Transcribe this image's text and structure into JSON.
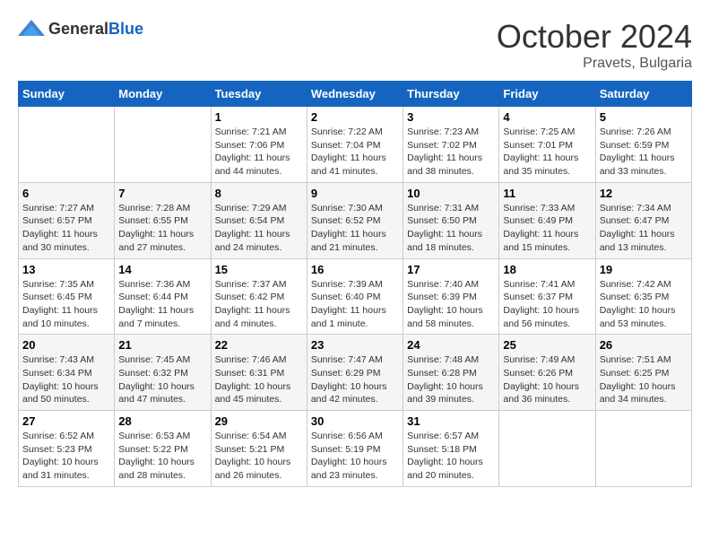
{
  "header": {
    "logo_general": "General",
    "logo_blue": "Blue",
    "month": "October 2024",
    "location": "Pravets, Bulgaria"
  },
  "weekdays": [
    "Sunday",
    "Monday",
    "Tuesday",
    "Wednesday",
    "Thursday",
    "Friday",
    "Saturday"
  ],
  "days": [
    {
      "date": null,
      "number": null
    },
    {
      "date": null,
      "number": null
    },
    {
      "number": "1",
      "sunrise": "Sunrise: 7:21 AM",
      "sunset": "Sunset: 7:06 PM",
      "daylight": "Daylight: 11 hours and 44 minutes."
    },
    {
      "number": "2",
      "sunrise": "Sunrise: 7:22 AM",
      "sunset": "Sunset: 7:04 PM",
      "daylight": "Daylight: 11 hours and 41 minutes."
    },
    {
      "number": "3",
      "sunrise": "Sunrise: 7:23 AM",
      "sunset": "Sunset: 7:02 PM",
      "daylight": "Daylight: 11 hours and 38 minutes."
    },
    {
      "number": "4",
      "sunrise": "Sunrise: 7:25 AM",
      "sunset": "Sunset: 7:01 PM",
      "daylight": "Daylight: 11 hours and 35 minutes."
    },
    {
      "number": "5",
      "sunrise": "Sunrise: 7:26 AM",
      "sunset": "Sunset: 6:59 PM",
      "daylight": "Daylight: 11 hours and 33 minutes."
    },
    {
      "number": "6",
      "sunrise": "Sunrise: 7:27 AM",
      "sunset": "Sunset: 6:57 PM",
      "daylight": "Daylight: 11 hours and 30 minutes."
    },
    {
      "number": "7",
      "sunrise": "Sunrise: 7:28 AM",
      "sunset": "Sunset: 6:55 PM",
      "daylight": "Daylight: 11 hours and 27 minutes."
    },
    {
      "number": "8",
      "sunrise": "Sunrise: 7:29 AM",
      "sunset": "Sunset: 6:54 PM",
      "daylight": "Daylight: 11 hours and 24 minutes."
    },
    {
      "number": "9",
      "sunrise": "Sunrise: 7:30 AM",
      "sunset": "Sunset: 6:52 PM",
      "daylight": "Daylight: 11 hours and 21 minutes."
    },
    {
      "number": "10",
      "sunrise": "Sunrise: 7:31 AM",
      "sunset": "Sunset: 6:50 PM",
      "daylight": "Daylight: 11 hours and 18 minutes."
    },
    {
      "number": "11",
      "sunrise": "Sunrise: 7:33 AM",
      "sunset": "Sunset: 6:49 PM",
      "daylight": "Daylight: 11 hours and 15 minutes."
    },
    {
      "number": "12",
      "sunrise": "Sunrise: 7:34 AM",
      "sunset": "Sunset: 6:47 PM",
      "daylight": "Daylight: 11 hours and 13 minutes."
    },
    {
      "number": "13",
      "sunrise": "Sunrise: 7:35 AM",
      "sunset": "Sunset: 6:45 PM",
      "daylight": "Daylight: 11 hours and 10 minutes."
    },
    {
      "number": "14",
      "sunrise": "Sunrise: 7:36 AM",
      "sunset": "Sunset: 6:44 PM",
      "daylight": "Daylight: 11 hours and 7 minutes."
    },
    {
      "number": "15",
      "sunrise": "Sunrise: 7:37 AM",
      "sunset": "Sunset: 6:42 PM",
      "daylight": "Daylight: 11 hours and 4 minutes."
    },
    {
      "number": "16",
      "sunrise": "Sunrise: 7:39 AM",
      "sunset": "Sunset: 6:40 PM",
      "daylight": "Daylight: 11 hours and 1 minute."
    },
    {
      "number": "17",
      "sunrise": "Sunrise: 7:40 AM",
      "sunset": "Sunset: 6:39 PM",
      "daylight": "Daylight: 10 hours and 58 minutes."
    },
    {
      "number": "18",
      "sunrise": "Sunrise: 7:41 AM",
      "sunset": "Sunset: 6:37 PM",
      "daylight": "Daylight: 10 hours and 56 minutes."
    },
    {
      "number": "19",
      "sunrise": "Sunrise: 7:42 AM",
      "sunset": "Sunset: 6:35 PM",
      "daylight": "Daylight: 10 hours and 53 minutes."
    },
    {
      "number": "20",
      "sunrise": "Sunrise: 7:43 AM",
      "sunset": "Sunset: 6:34 PM",
      "daylight": "Daylight: 10 hours and 50 minutes."
    },
    {
      "number": "21",
      "sunrise": "Sunrise: 7:45 AM",
      "sunset": "Sunset: 6:32 PM",
      "daylight": "Daylight: 10 hours and 47 minutes."
    },
    {
      "number": "22",
      "sunrise": "Sunrise: 7:46 AM",
      "sunset": "Sunset: 6:31 PM",
      "daylight": "Daylight: 10 hours and 45 minutes."
    },
    {
      "number": "23",
      "sunrise": "Sunrise: 7:47 AM",
      "sunset": "Sunset: 6:29 PM",
      "daylight": "Daylight: 10 hours and 42 minutes."
    },
    {
      "number": "24",
      "sunrise": "Sunrise: 7:48 AM",
      "sunset": "Sunset: 6:28 PM",
      "daylight": "Daylight: 10 hours and 39 minutes."
    },
    {
      "number": "25",
      "sunrise": "Sunrise: 7:49 AM",
      "sunset": "Sunset: 6:26 PM",
      "daylight": "Daylight: 10 hours and 36 minutes."
    },
    {
      "number": "26",
      "sunrise": "Sunrise: 7:51 AM",
      "sunset": "Sunset: 6:25 PM",
      "daylight": "Daylight: 10 hours and 34 minutes."
    },
    {
      "number": "27",
      "sunrise": "Sunrise: 6:52 AM",
      "sunset": "Sunset: 5:23 PM",
      "daylight": "Daylight: 10 hours and 31 minutes."
    },
    {
      "number": "28",
      "sunrise": "Sunrise: 6:53 AM",
      "sunset": "Sunset: 5:22 PM",
      "daylight": "Daylight: 10 hours and 28 minutes."
    },
    {
      "number": "29",
      "sunrise": "Sunrise: 6:54 AM",
      "sunset": "Sunset: 5:21 PM",
      "daylight": "Daylight: 10 hours and 26 minutes."
    },
    {
      "number": "30",
      "sunrise": "Sunrise: 6:56 AM",
      "sunset": "Sunset: 5:19 PM",
      "daylight": "Daylight: 10 hours and 23 minutes."
    },
    {
      "number": "31",
      "sunrise": "Sunrise: 6:57 AM",
      "sunset": "Sunset: 5:18 PM",
      "daylight": "Daylight: 10 hours and 20 minutes."
    },
    {
      "date": null,
      "number": null
    },
    {
      "date": null,
      "number": null
    }
  ]
}
